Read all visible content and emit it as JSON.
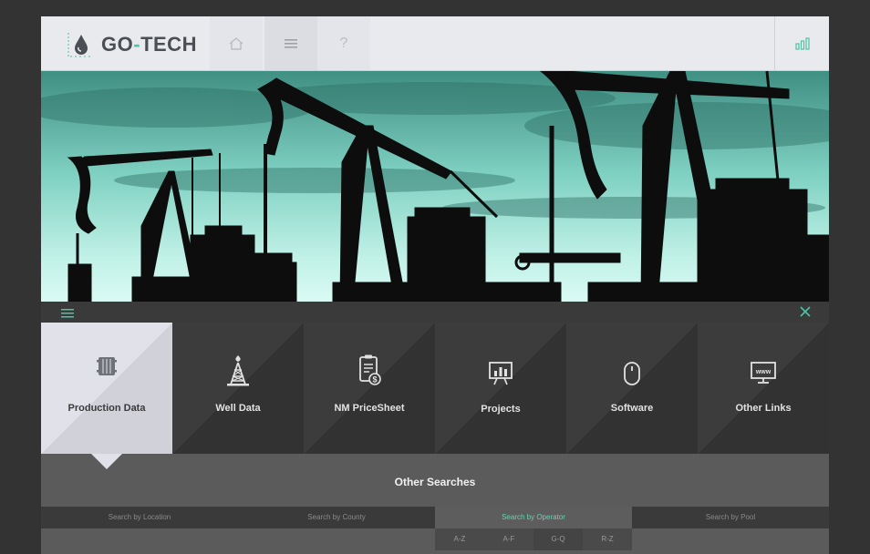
{
  "brand": {
    "name_part1": "GO",
    "name_dash": "-",
    "name_part2": "TECH",
    "accent_color": "#4ec3a5"
  },
  "header": {
    "nav": [
      {
        "icon": "home-icon"
      },
      {
        "icon": "menu-icon"
      },
      {
        "icon": "help-icon",
        "label": "?"
      }
    ],
    "stats_icon": "bar-chart-icon"
  },
  "hero": {
    "description": "oil pumpjacks silhouette banner"
  },
  "tiles": [
    {
      "label": "Production Data",
      "icon": "barrel-icon",
      "active": true
    },
    {
      "label": "Well Data",
      "icon": "oil-derrick-icon",
      "active": false
    },
    {
      "label": "NM PriceSheet",
      "icon": "price-sheet-icon",
      "active": false
    },
    {
      "label": "Projects",
      "icon": "presentation-chart-icon",
      "active": false
    },
    {
      "label": "Software",
      "icon": "mouse-icon",
      "active": false
    },
    {
      "label": "Other Links",
      "icon": "web-icon",
      "active": false
    }
  ],
  "other_searches": {
    "title": "Other Searches",
    "tabs": [
      {
        "label": "Search by Location"
      },
      {
        "label": "Search by County"
      },
      {
        "label": "Search by Operator",
        "active": true
      },
      {
        "label": "Search by Pool"
      }
    ],
    "subtabs": [
      "A-Z",
      "A-F",
      "G-Q",
      "R-Z"
    ]
  }
}
